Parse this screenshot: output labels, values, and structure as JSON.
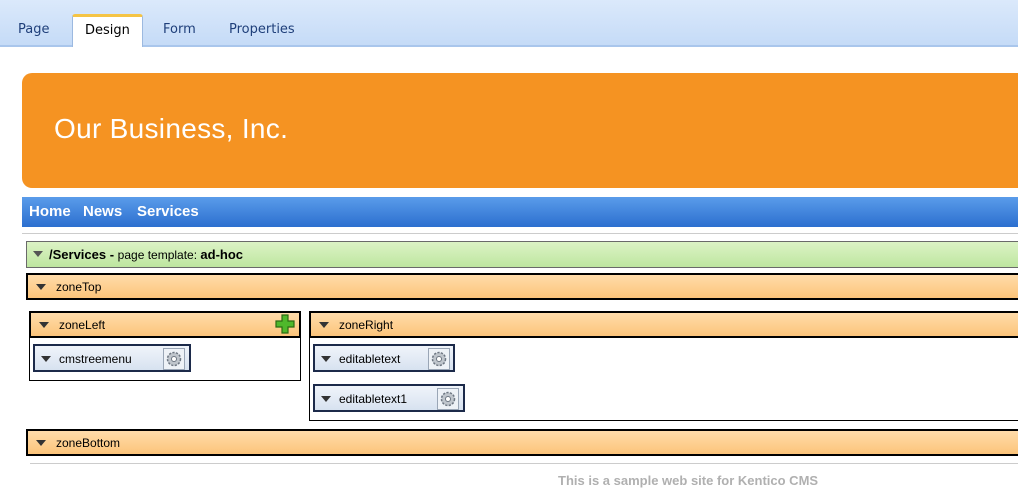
{
  "tabs": [
    {
      "label": "Page"
    },
    {
      "label": "Design"
    },
    {
      "label": "Form"
    },
    {
      "label": "Properties"
    }
  ],
  "active_tab": "Design",
  "banner": {
    "title": "Our Business, Inc."
  },
  "menu": {
    "items": [
      "Home",
      "News",
      "Services"
    ]
  },
  "template_bar": {
    "path": "/Services",
    "separator": " - ",
    "prefix": "page template: ",
    "template": "ad-hoc"
  },
  "zones": {
    "top": {
      "label": "zoneTop"
    },
    "left": {
      "label": "zoneLeft",
      "webparts": [
        {
          "label": "cmstreemenu"
        }
      ]
    },
    "right": {
      "label": "zoneRight",
      "webparts": [
        {
          "label": "editabletext"
        },
        {
          "label": "editabletext1"
        }
      ]
    },
    "bottom": {
      "label": "zoneBottom"
    }
  },
  "footer": {
    "text": "This is a sample web site for Kentico CMS"
  },
  "colors": {
    "banner": "#f59322",
    "menu": "#2c6fcf",
    "zone_bar": "#fcc47a",
    "template_bar": "#bee6a0"
  },
  "icons": [
    "arrow-down-icon",
    "gear-icon",
    "add-webpart-icon"
  ]
}
